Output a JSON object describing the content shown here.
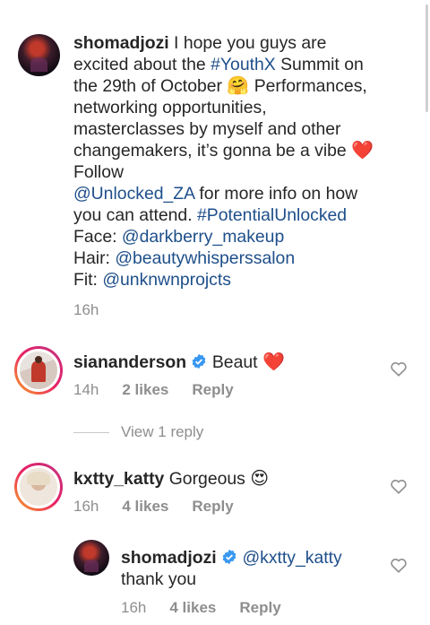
{
  "caption": {
    "username": "shomadjozi",
    "line1": " I hope you guys are",
    "line2_a": "excited about the ",
    "line2_tag": "#YouthX",
    "line2_b": " Summit on",
    "line3": "the 29th of October ",
    "line3_emoji": "🤗",
    "line3_b": " Performances,",
    "line4": "networking opportunities,",
    "line5": "masterclasses by myself and other",
    "line6": "changemakers, it’s gonna be a vibe ",
    "line6_emoji": "❤️",
    "line7": "Follow",
    "line8_mention": "@Unlocked_ZA",
    "line8_b": " for more info on how",
    "line9_a": "you can attend. ",
    "line9_tag": "#PotentialUnlocked",
    "face_label": "Face: ",
    "face_mention": "@darkberry_makeup",
    "hair_label": "Hair: ",
    "hair_mention": "@beautywhisperssalon",
    "fit_label": "Fit: ",
    "fit_mention": "@unknwnprojcts",
    "time": "16h"
  },
  "comments": [
    {
      "username": "siananderson",
      "text": "Beaut",
      "emoji": "❤️",
      "time": "14h",
      "likes": "2 likes",
      "reply": "Reply"
    },
    {
      "username": "kxtty_katty",
      "text": "Gorgeous",
      "emoji": "😍",
      "time": "16h",
      "likes": "4 likes",
      "reply": "Reply"
    }
  ],
  "view_replies": "View 1 reply",
  "reply": {
    "username": "shomadjozi",
    "mention": "@kxtty_katty",
    "text": "thank you",
    "time": "16h",
    "likes": "4 likes",
    "reply": "Reply"
  },
  "colors": {
    "link": "#1e4f8a",
    "verified": "#3897f0",
    "heart": "#ed1c24",
    "meta": "#8e8e8e"
  }
}
